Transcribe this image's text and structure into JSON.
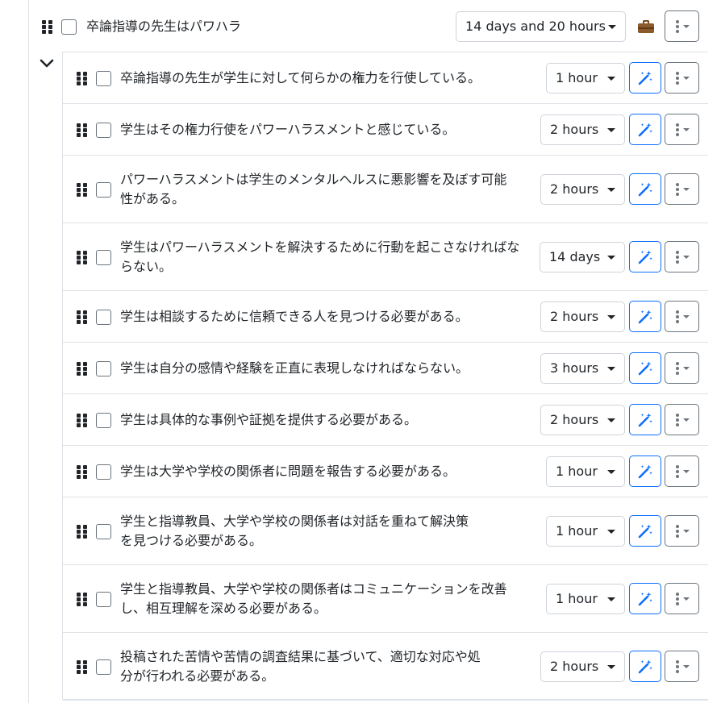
{
  "parent": {
    "title": "卒論指導の先生はパワハラ",
    "duration": "14 days and 20 hours"
  },
  "icons": {
    "drag_handle": "grip-icon",
    "briefcase": "briefcase-icon",
    "collapse": "chevron-down-icon",
    "magic": "magic-wand-icon",
    "menu": "kebab-menu-icon"
  },
  "colors": {
    "accent": "#0d6efd",
    "border": "#dee2e6",
    "muted": "#6c757d"
  },
  "children": [
    {
      "lines": [
        "卒論指導の先生が学生に対して何らかの権力を行使している。"
      ],
      "duration": "1 hour"
    },
    {
      "lines": [
        "学生はその権力行使をパワーハラスメントと感じている。"
      ],
      "duration": "2 hours"
    },
    {
      "lines": [
        "パワーハラスメントは学生のメンタルヘルスに悪影響を及ぼす可能",
        "性がある。"
      ],
      "duration": "2 hours"
    },
    {
      "lines": [
        "学生はパワーハラスメントを解決するために行動を起こさなければな",
        "らない。"
      ],
      "duration": "14 days"
    },
    {
      "lines": [
        "学生は相談するために信頼できる人を見つける必要がある。"
      ],
      "duration": "2 hours"
    },
    {
      "lines": [
        "学生は自分の感情や経験を正直に表現しなければならない。"
      ],
      "duration": "3 hours"
    },
    {
      "lines": [
        "学生は具体的な事例や証拠を提供する必要がある。"
      ],
      "duration": "2 hours"
    },
    {
      "lines": [
        "学生は大学や学校の関係者に問題を報告する必要がある。"
      ],
      "duration": "1 hour"
    },
    {
      "lines": [
        "学生と指導教員、大学や学校の関係者は対話を重ねて解決策",
        "を見つける必要がある。"
      ],
      "duration": "1 hour"
    },
    {
      "lines": [
        "学生と指導教員、大学や学校の関係者はコミュニケーションを改善",
        "し、相互理解を深める必要がある。"
      ],
      "duration": "1 hour"
    },
    {
      "lines": [
        "投稿された苦情や苦情の調査結果に基づいて、適切な対応や処",
        "分が行われる必要がある。"
      ],
      "duration": "2 hours"
    }
  ]
}
